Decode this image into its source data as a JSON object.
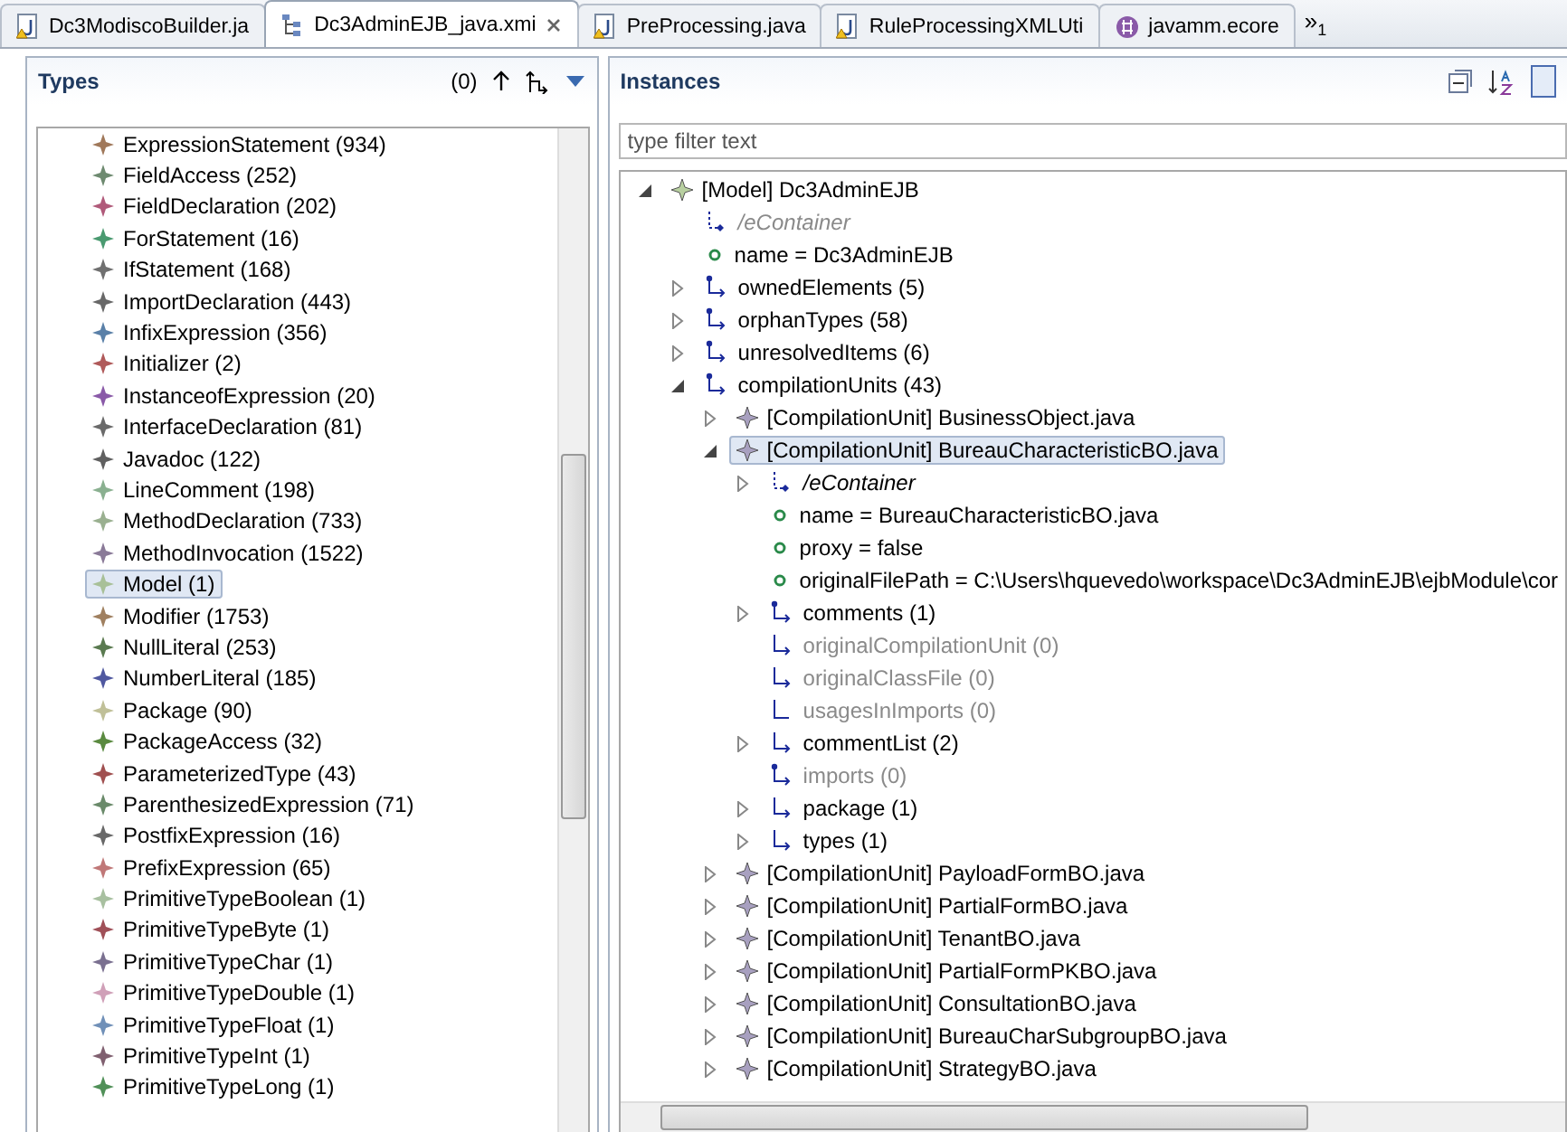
{
  "editor_tabs": [
    {
      "label": "Dc3ModiscoBuilder.ja",
      "kind": "java",
      "selected": false,
      "closable": false
    },
    {
      "label": "Dc3AdminEJB_java.xmi",
      "kind": "model",
      "selected": true,
      "closable": true
    },
    {
      "label": "PreProcessing.java",
      "kind": "java",
      "selected": false,
      "closable": false
    },
    {
      "label": "RuleProcessingXMLUti",
      "kind": "java",
      "selected": false,
      "closable": false
    },
    {
      "label": "javamm.ecore",
      "kind": "ecore",
      "selected": false,
      "closable": false
    }
  ],
  "tab_overflow": {
    "label": "»",
    "count": "1"
  },
  "types_panel": {
    "title": "Types",
    "count": "(0)",
    "items": [
      {
        "label": "ExpressionStatement (934)",
        "color": "#a0785a",
        "selected": false
      },
      {
        "label": "FieldAccess (252)",
        "color": "#6e8a70",
        "selected": false
      },
      {
        "label": "FieldDeclaration (202)",
        "color": "#b05a7a",
        "selected": false
      },
      {
        "label": "ForStatement (16)",
        "color": "#4a9a70",
        "selected": false
      },
      {
        "label": "IfStatement (168)",
        "color": "#707070",
        "selected": false
      },
      {
        "label": "ImportDeclaration (443)",
        "color": "#686868",
        "selected": false
      },
      {
        "label": "InfixExpression (356)",
        "color": "#5a80a8",
        "selected": false
      },
      {
        "label": "Initializer (2)",
        "color": "#b05a5a",
        "selected": false
      },
      {
        "label": "InstanceofExpression (20)",
        "color": "#8a5aa8",
        "selected": false
      },
      {
        "label": "InterfaceDeclaration (81)",
        "color": "#6a6a6a",
        "selected": false
      },
      {
        "label": "Javadoc (122)",
        "color": "#606060",
        "selected": false
      },
      {
        "label": "LineComment (198)",
        "color": "#8ab090",
        "selected": false
      },
      {
        "label": "MethodDeclaration (733)",
        "color": "#9ab090",
        "selected": false
      },
      {
        "label": "MethodInvocation (1522)",
        "color": "#8a7a98",
        "selected": false
      },
      {
        "label": "Model (1)",
        "color": "#a8c098",
        "selected": true
      },
      {
        "label": "Modifier (1753)",
        "color": "#a08060",
        "selected": false
      },
      {
        "label": "NullLiteral (253)",
        "color": "#5a7a50",
        "selected": false
      },
      {
        "label": "NumberLiteral (185)",
        "color": "#5058a0",
        "selected": false
      },
      {
        "label": "Package (90)",
        "color": "#c0c098",
        "selected": false
      },
      {
        "label": "PackageAccess (32)",
        "color": "#5a8a40",
        "selected": false
      },
      {
        "label": "ParameterizedType (43)",
        "color": "#a05050",
        "selected": false
      },
      {
        "label": "ParenthesizedExpression (71)",
        "color": "#6a8a6a",
        "selected": false
      },
      {
        "label": "PostfixExpression (16)",
        "color": "#686868",
        "selected": false
      },
      {
        "label": "PrefixExpression (65)",
        "color": "#c07878",
        "selected": false
      },
      {
        "label": "PrimitiveTypeBoolean (1)",
        "color": "#a8c0a0",
        "selected": false
      },
      {
        "label": "PrimitiveTypeByte (1)",
        "color": "#a05058",
        "selected": false
      },
      {
        "label": "PrimitiveTypeChar (1)",
        "color": "#7a7090",
        "selected": false
      },
      {
        "label": "PrimitiveTypeDouble (1)",
        "color": "#d0a0b8",
        "selected": false
      },
      {
        "label": "PrimitiveTypeFloat (1)",
        "color": "#7090b8",
        "selected": false
      },
      {
        "label": "PrimitiveTypeInt (1)",
        "color": "#806070",
        "selected": false
      },
      {
        "label": "PrimitiveTypeLong (1)",
        "color": "#509058",
        "selected": false
      }
    ]
  },
  "instances_panel": {
    "title": "Instances",
    "filter": {
      "placeholder": "type filter text"
    },
    "tree": [
      {
        "label": "[Model] Dc3AdminEJB",
        "kind": "model",
        "expanded": true,
        "selected": false,
        "disabled": false,
        "children": [
          {
            "label": "/eContainer",
            "kind": "derived",
            "selected": false,
            "disabled": true
          },
          {
            "label": "name = Dc3AdminEJB",
            "kind": "attribute",
            "selected": false,
            "disabled": false
          },
          {
            "label": "ownedElements (5)",
            "kind": "containment",
            "expanded": false,
            "selected": false,
            "disabled": false
          },
          {
            "label": "orphanTypes (58)",
            "kind": "containment",
            "expanded": false,
            "selected": false,
            "disabled": false
          },
          {
            "label": "unresolvedItems (6)",
            "kind": "containment",
            "expanded": false,
            "selected": false,
            "disabled": false
          },
          {
            "label": "compilationUnits (43)",
            "kind": "containment",
            "expanded": true,
            "selected": false,
            "disabled": false,
            "children": [
              {
                "label": "[CompilationUnit] BusinessObject.java",
                "kind": "object",
                "expanded": false,
                "selected": false,
                "disabled": false
              },
              {
                "label": "[CompilationUnit] BureauCharacteristicBO.java",
                "kind": "object",
                "expanded": true,
                "selected": true,
                "disabled": false,
                "children": [
                  {
                    "label": "/eContainer",
                    "kind": "derived",
                    "expanded": false,
                    "selected": false,
                    "disabled": false
                  },
                  {
                    "label": "name = BureauCharacteristicBO.java",
                    "kind": "attribute",
                    "selected": false,
                    "disabled": false
                  },
                  {
                    "label": "proxy = false",
                    "kind": "attribute",
                    "selected": false,
                    "disabled": false
                  },
                  {
                    "label": "originalFilePath = C:\\Users\\hquevedo\\workspace\\Dc3AdminEJB\\ejbModule\\cor",
                    "kind": "attribute",
                    "selected": false,
                    "disabled": false
                  },
                  {
                    "label": "comments (1)",
                    "kind": "containment",
                    "expanded": false,
                    "selected": false,
                    "disabled": false
                  },
                  {
                    "label": "originalCompilationUnit (0)",
                    "kind": "reference",
                    "selected": false,
                    "disabled": true
                  },
                  {
                    "label": "originalClassFile (0)",
                    "kind": "reference",
                    "selected": false,
                    "disabled": true
                  },
                  {
                    "label": "usagesInImports (0)",
                    "kind": "list",
                    "selected": false,
                    "disabled": true
                  },
                  {
                    "label": "commentList (2)",
                    "kind": "reference",
                    "expanded": false,
                    "selected": false,
                    "disabled": false
                  },
                  {
                    "label": "imports (0)",
                    "kind": "containment",
                    "selected": false,
                    "disabled": true
                  },
                  {
                    "label": "package (1)",
                    "kind": "reference",
                    "expanded": false,
                    "selected": false,
                    "disabled": false
                  },
                  {
                    "label": "types (1)",
                    "kind": "reference",
                    "expanded": false,
                    "selected": false,
                    "disabled": false
                  }
                ]
              },
              {
                "label": "[CompilationUnit] PayloadFormBO.java",
                "kind": "object",
                "expanded": false,
                "selected": false,
                "disabled": false
              },
              {
                "label": "[CompilationUnit] PartialFormBO.java",
                "kind": "object",
                "expanded": false,
                "selected": false,
                "disabled": false
              },
              {
                "label": "[CompilationUnit] TenantBO.java",
                "kind": "object",
                "expanded": false,
                "selected": false,
                "disabled": false
              },
              {
                "label": "[CompilationUnit] PartialFormPKBO.java",
                "kind": "object",
                "expanded": false,
                "selected": false,
                "disabled": false
              },
              {
                "label": "[CompilationUnit] ConsultationBO.java",
                "kind": "object",
                "expanded": false,
                "selected": false,
                "disabled": false
              },
              {
                "label": "[CompilationUnit] BureauCharSubgroupBO.java",
                "kind": "object",
                "expanded": false,
                "selected": false,
                "disabled": false
              },
              {
                "label": "[CompilationUnit] StrategyBO.java",
                "kind": "object",
                "expanded": false,
                "selected": false,
                "disabled": false
              }
            ]
          }
        ]
      }
    ]
  }
}
